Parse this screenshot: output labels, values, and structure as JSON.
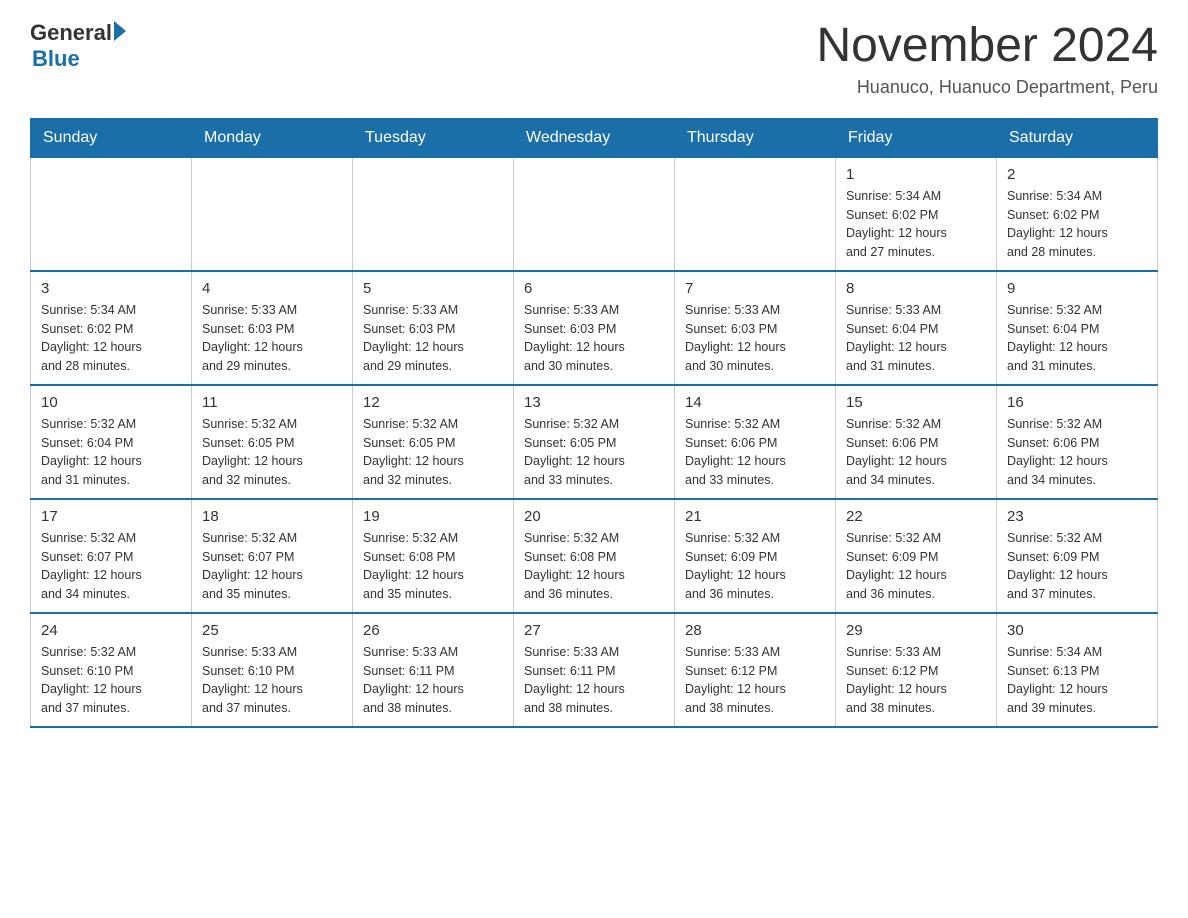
{
  "header": {
    "logo_general": "General",
    "logo_blue": "Blue",
    "month_title": "November 2024",
    "location": "Huanuco, Huanuco Department, Peru"
  },
  "weekdays": [
    "Sunday",
    "Monday",
    "Tuesday",
    "Wednesday",
    "Thursday",
    "Friday",
    "Saturday"
  ],
  "weeks": [
    [
      {
        "day": "",
        "info": ""
      },
      {
        "day": "",
        "info": ""
      },
      {
        "day": "",
        "info": ""
      },
      {
        "day": "",
        "info": ""
      },
      {
        "day": "",
        "info": ""
      },
      {
        "day": "1",
        "info": "Sunrise: 5:34 AM\nSunset: 6:02 PM\nDaylight: 12 hours\nand 27 minutes."
      },
      {
        "day": "2",
        "info": "Sunrise: 5:34 AM\nSunset: 6:02 PM\nDaylight: 12 hours\nand 28 minutes."
      }
    ],
    [
      {
        "day": "3",
        "info": "Sunrise: 5:34 AM\nSunset: 6:02 PM\nDaylight: 12 hours\nand 28 minutes."
      },
      {
        "day": "4",
        "info": "Sunrise: 5:33 AM\nSunset: 6:03 PM\nDaylight: 12 hours\nand 29 minutes."
      },
      {
        "day": "5",
        "info": "Sunrise: 5:33 AM\nSunset: 6:03 PM\nDaylight: 12 hours\nand 29 minutes."
      },
      {
        "day": "6",
        "info": "Sunrise: 5:33 AM\nSunset: 6:03 PM\nDaylight: 12 hours\nand 30 minutes."
      },
      {
        "day": "7",
        "info": "Sunrise: 5:33 AM\nSunset: 6:03 PM\nDaylight: 12 hours\nand 30 minutes."
      },
      {
        "day": "8",
        "info": "Sunrise: 5:33 AM\nSunset: 6:04 PM\nDaylight: 12 hours\nand 31 minutes."
      },
      {
        "day": "9",
        "info": "Sunrise: 5:32 AM\nSunset: 6:04 PM\nDaylight: 12 hours\nand 31 minutes."
      }
    ],
    [
      {
        "day": "10",
        "info": "Sunrise: 5:32 AM\nSunset: 6:04 PM\nDaylight: 12 hours\nand 31 minutes."
      },
      {
        "day": "11",
        "info": "Sunrise: 5:32 AM\nSunset: 6:05 PM\nDaylight: 12 hours\nand 32 minutes."
      },
      {
        "day": "12",
        "info": "Sunrise: 5:32 AM\nSunset: 6:05 PM\nDaylight: 12 hours\nand 32 minutes."
      },
      {
        "day": "13",
        "info": "Sunrise: 5:32 AM\nSunset: 6:05 PM\nDaylight: 12 hours\nand 33 minutes."
      },
      {
        "day": "14",
        "info": "Sunrise: 5:32 AM\nSunset: 6:06 PM\nDaylight: 12 hours\nand 33 minutes."
      },
      {
        "day": "15",
        "info": "Sunrise: 5:32 AM\nSunset: 6:06 PM\nDaylight: 12 hours\nand 34 minutes."
      },
      {
        "day": "16",
        "info": "Sunrise: 5:32 AM\nSunset: 6:06 PM\nDaylight: 12 hours\nand 34 minutes."
      }
    ],
    [
      {
        "day": "17",
        "info": "Sunrise: 5:32 AM\nSunset: 6:07 PM\nDaylight: 12 hours\nand 34 minutes."
      },
      {
        "day": "18",
        "info": "Sunrise: 5:32 AM\nSunset: 6:07 PM\nDaylight: 12 hours\nand 35 minutes."
      },
      {
        "day": "19",
        "info": "Sunrise: 5:32 AM\nSunset: 6:08 PM\nDaylight: 12 hours\nand 35 minutes."
      },
      {
        "day": "20",
        "info": "Sunrise: 5:32 AM\nSunset: 6:08 PM\nDaylight: 12 hours\nand 36 minutes."
      },
      {
        "day": "21",
        "info": "Sunrise: 5:32 AM\nSunset: 6:09 PM\nDaylight: 12 hours\nand 36 minutes."
      },
      {
        "day": "22",
        "info": "Sunrise: 5:32 AM\nSunset: 6:09 PM\nDaylight: 12 hours\nand 36 minutes."
      },
      {
        "day": "23",
        "info": "Sunrise: 5:32 AM\nSunset: 6:09 PM\nDaylight: 12 hours\nand 37 minutes."
      }
    ],
    [
      {
        "day": "24",
        "info": "Sunrise: 5:32 AM\nSunset: 6:10 PM\nDaylight: 12 hours\nand 37 minutes."
      },
      {
        "day": "25",
        "info": "Sunrise: 5:33 AM\nSunset: 6:10 PM\nDaylight: 12 hours\nand 37 minutes."
      },
      {
        "day": "26",
        "info": "Sunrise: 5:33 AM\nSunset: 6:11 PM\nDaylight: 12 hours\nand 38 minutes."
      },
      {
        "day": "27",
        "info": "Sunrise: 5:33 AM\nSunset: 6:11 PM\nDaylight: 12 hours\nand 38 minutes."
      },
      {
        "day": "28",
        "info": "Sunrise: 5:33 AM\nSunset: 6:12 PM\nDaylight: 12 hours\nand 38 minutes."
      },
      {
        "day": "29",
        "info": "Sunrise: 5:33 AM\nSunset: 6:12 PM\nDaylight: 12 hours\nand 38 minutes."
      },
      {
        "day": "30",
        "info": "Sunrise: 5:34 AM\nSunset: 6:13 PM\nDaylight: 12 hours\nand 39 minutes."
      }
    ]
  ]
}
